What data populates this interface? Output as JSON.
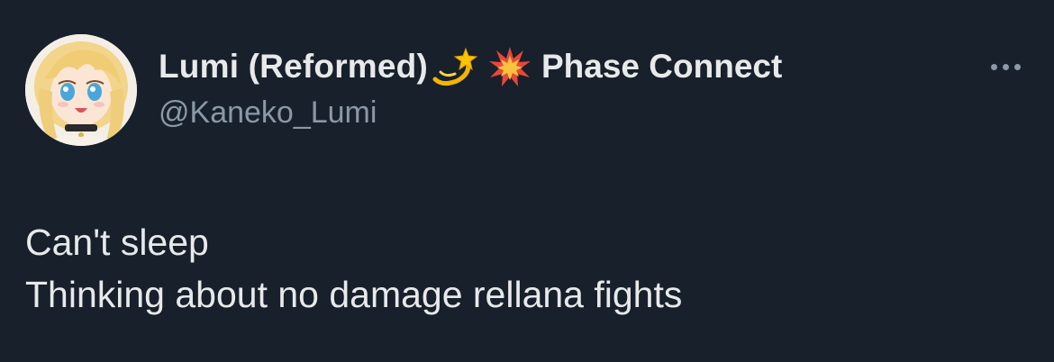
{
  "author": {
    "display_name": "Lumi (Reformed)",
    "emoji_1": "dizzy-icon",
    "emoji_2": "collision-icon",
    "org_name": "Phase Connect",
    "handle": "@Kaneko_Lumi"
  },
  "tweet": {
    "lines": [
      "Can't sleep",
      "Thinking about no damage rellana fights"
    ]
  },
  "more_button": {
    "icon": "more-horizontal-icon"
  },
  "colors": {
    "background": "#17202b",
    "text": "#e7e9ea",
    "muted": "#8b98a5"
  }
}
